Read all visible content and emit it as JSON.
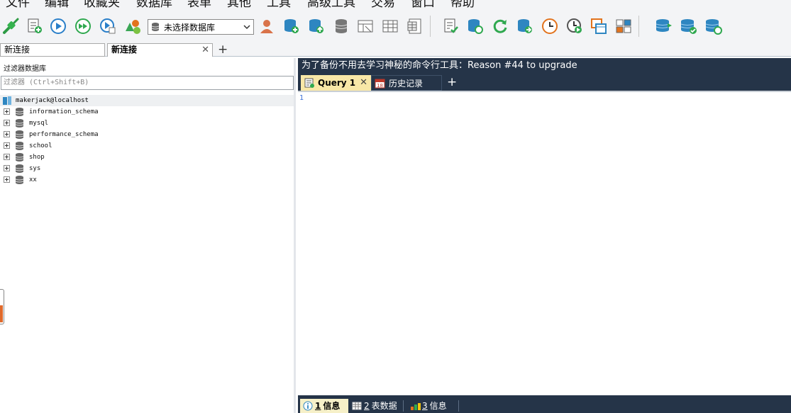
{
  "menu": {
    "items": [
      "文件",
      "编辑",
      "收藏夹",
      "数据库",
      "表单",
      "其他",
      "工具",
      "高级工具",
      "交易",
      "窗口",
      "帮助"
    ]
  },
  "toolbar": {
    "database_select": {
      "value": "未选择数据库"
    },
    "icons": [
      "connect-icon",
      "new-query-icon",
      "execute-icon",
      "execute-all-icon",
      "execute-current-icon",
      "schema-designer-icon",
      "user-manager-icon",
      "create-database-icon",
      "backup-database-icon",
      "restore-database-icon",
      "table-icon",
      "table-data-icon",
      "view-icon",
      "query-builder-icon",
      "sync-schema-icon",
      "refresh-icon",
      "import-icon",
      "schedule-icon",
      "run-job-icon",
      "export-icon",
      "compare-icon",
      "copy-database-icon",
      "sync-data-icon",
      "migrate-icon"
    ]
  },
  "connection_tabs": [
    {
      "label": "新连接",
      "active": false
    },
    {
      "label": "新连接",
      "active": true
    }
  ],
  "connection_tab_add": "+",
  "left_panel": {
    "filter_label": "过滤器数据库",
    "filter_placeholder": "过滤器 (Ctrl+Shift+B)",
    "root": "makerjack@localhost",
    "databases": [
      "information_schema",
      "mysql",
      "performance_schema",
      "school",
      "shop",
      "sys",
      "xx"
    ]
  },
  "right_panel": {
    "banner": "为了备份不用去学习神秘的命令行工具：Reason #44 to upgrade",
    "query_tabs": [
      {
        "label": "Query 1",
        "active": true,
        "closable": true
      },
      {
        "label": "历史记录",
        "active": false,
        "closable": false
      }
    ],
    "query_tab_add": "+",
    "editor_line_number": "1",
    "bottom_tabs": [
      {
        "num": "1",
        "label": "信息",
        "active": true
      },
      {
        "num": "2",
        "label": "表数据",
        "active": false
      },
      {
        "num": "3",
        "label": "信息",
        "active": false
      }
    ]
  },
  "colors": {
    "dark_header": "#253448",
    "active_query_tab": "#f8e7a7",
    "toolbar_bg": "#f3f4f6",
    "accent_blue": "#2e86c1"
  }
}
